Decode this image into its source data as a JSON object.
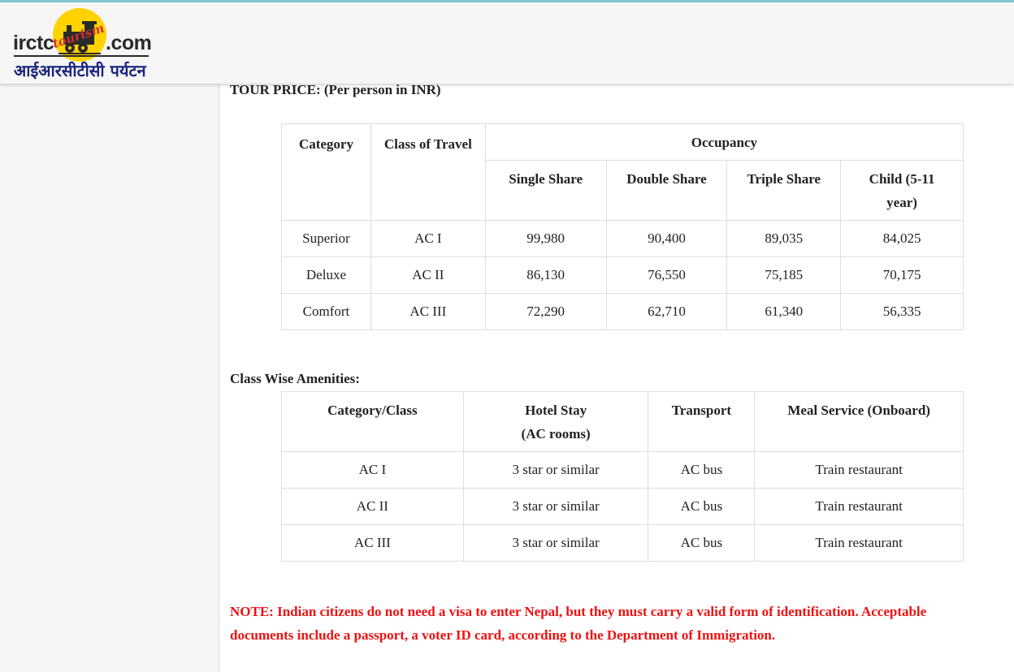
{
  "brand": {
    "left_word": "irctc",
    "right_word": ".com",
    "circle_text": "tourism",
    "hindi": "आईआरसीटीसी पर्यटन",
    "accent_color": "#ffd200",
    "text_color": "#1a237e"
  },
  "tour_price": {
    "title": "TOUR PRICE: (Per person in INR)",
    "headers": {
      "category": "Category",
      "class_of_travel": "Class of Travel",
      "occupancy": "Occupancy",
      "single": "Single Share",
      "double": "Double Share",
      "triple": "Triple Share",
      "child": "Child (5-11 year)"
    },
    "rows": [
      {
        "category": "Superior",
        "class": "AC I",
        "single": "99,980",
        "double": "90,400",
        "triple": "89,035",
        "child": "84,025"
      },
      {
        "category": "Deluxe",
        "class": "AC II",
        "single": "86,130",
        "double": "76,550",
        "triple": "75,185",
        "child": "70,175"
      },
      {
        "category": "Comfort",
        "class": "AC III",
        "single": "72,290",
        "double": "62,710",
        "triple": "61,340",
        "child": "56,335"
      }
    ]
  },
  "amenities": {
    "title": "Class Wise Amenities:",
    "headers": {
      "category_class": "Category/Class",
      "hotel_line1": "Hotel Stay",
      "hotel_line2": "(AC rooms)",
      "transport": "Transport",
      "meal": "Meal Service (Onboard)"
    },
    "rows": [
      {
        "class": "AC I",
        "hotel": "3 star or similar",
        "transport": "AC bus",
        "meal": "Train restaurant"
      },
      {
        "class": "AC II",
        "hotel": "3 star or similar",
        "transport": "AC bus",
        "meal": "Train restaurant"
      },
      {
        "class": "AC III",
        "hotel": "3 star or similar",
        "transport": "AC bus",
        "meal": "Train restaurant"
      }
    ]
  },
  "note": "NOTE: Indian citizens do not need a visa to enter Nepal, but they must carry a valid form of identification. Acceptable documents include a passport, a voter ID card, according to the Department of Immigration.",
  "colors": {
    "note_red": "#ee1111",
    "border": "#dedede",
    "header_bg": "#f6f6f6",
    "top_line": "#7ec8cf"
  }
}
